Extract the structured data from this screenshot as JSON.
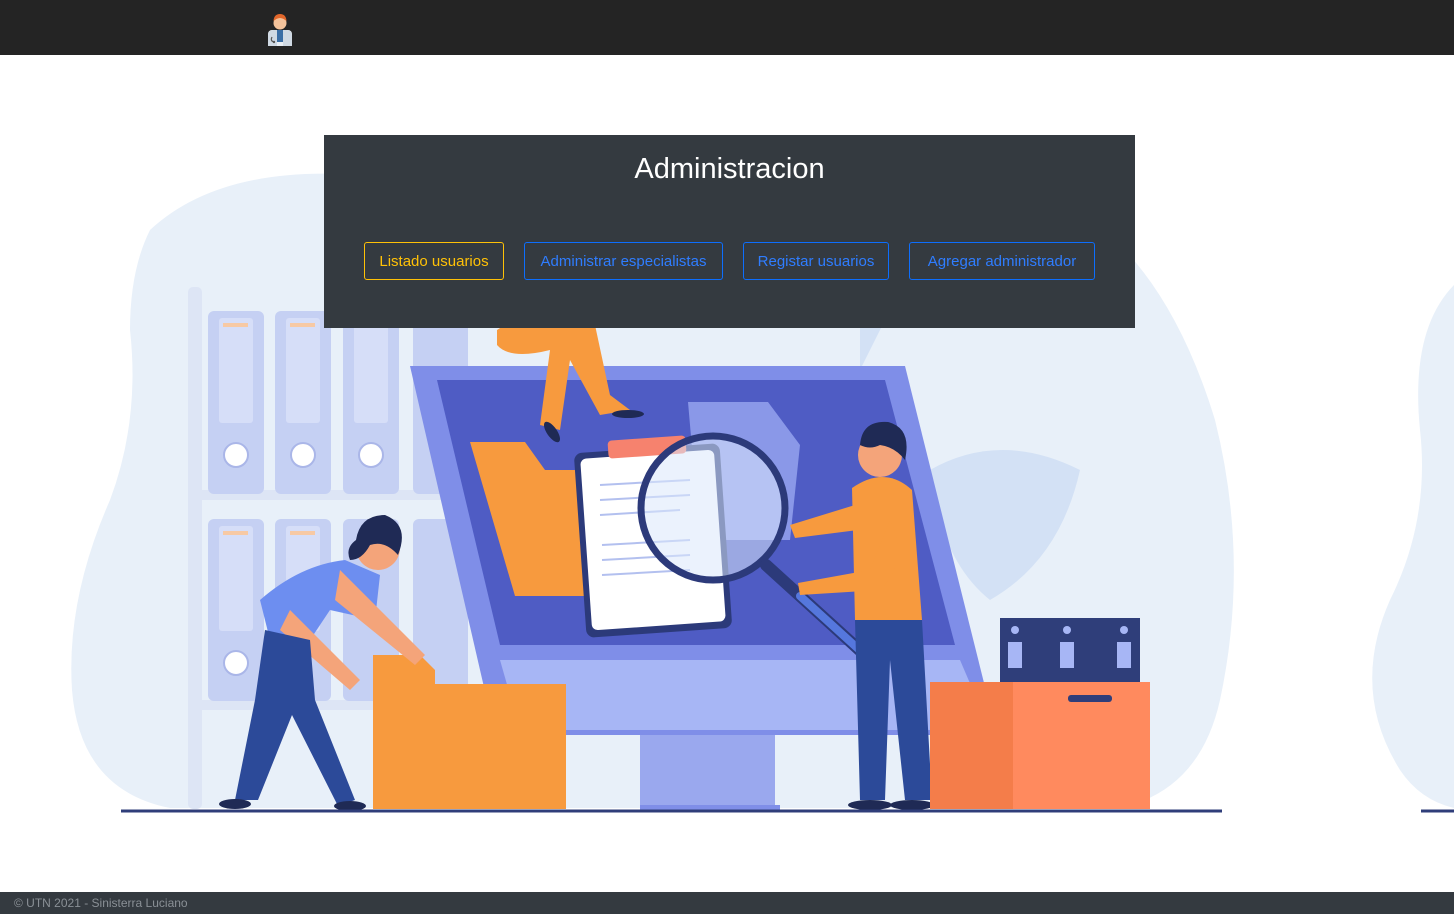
{
  "header": {
    "logo_icon": "doctor-avatar-icon"
  },
  "admin_panel": {
    "title": "Administracion",
    "buttons": [
      {
        "label": "Listado usuarios",
        "style": "warning"
      },
      {
        "label": "Administrar especialistas",
        "style": "primary"
      },
      {
        "label": "Registar usuarios",
        "style": "primary"
      },
      {
        "label": "Agregar administrador",
        "style": "primary"
      }
    ]
  },
  "footer": {
    "text": "© UTN 2021 - Sinisterra Luciano"
  },
  "colors": {
    "topbar": "#242424",
    "panel": "#343a40",
    "warning": "#ffc107",
    "primary": "#0d6efd",
    "illustration_accent": "#f79a3e",
    "illustration_indigo": "#4f5cc4"
  }
}
